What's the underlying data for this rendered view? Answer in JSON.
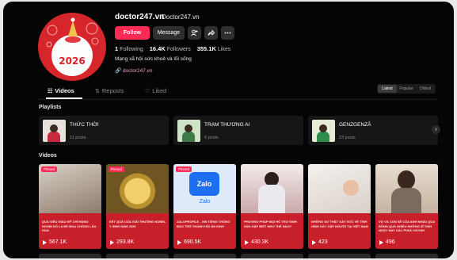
{
  "profile": {
    "username": "doctor247.vn",
    "handle": "Doctor247.vn",
    "avatar_year": "2026",
    "follow_label": "Follow",
    "message_label": "Message",
    "following_count": "1",
    "following_label": "Following",
    "followers_count": "16.4K",
    "followers_label": "Followers",
    "likes_count": "355.1K",
    "likes_label": "Likes",
    "bio": "Mạng xã hội sức khoẻ và lối sống",
    "link": "doctor247.vn"
  },
  "tabs": {
    "videos": "Videos",
    "reposts": "Reposts",
    "liked": "Liked"
  },
  "sort": {
    "latest": "Latest",
    "popular": "Popular",
    "oldest": "Oldest"
  },
  "sections": {
    "playlists": "Playlists",
    "videos": "Videos"
  },
  "playlists": [
    {
      "title": "THỨC THỜI",
      "count": "11 posts"
    },
    {
      "title": "TRẠM THƯƠNG AI",
      "count": "6 posts"
    },
    {
      "title": "GENZGENZĂ",
      "count": "23 posts"
    }
  ],
  "videos": [
    {
      "pinned": "Pinned",
      "caption": "Quá siêu giàu mỹ chỉ hàng nghìn đô la để mua chồng lâu hoa",
      "views": "567.1K"
    },
    {
      "pinned": "Pinned",
      "caption": "Kết quả của giải thưởng Nobel y sinh năm 2025",
      "views": "293.8K"
    },
    {
      "pinned": "Pinned",
      "caption": "Zaloprofile - xin tiếng thông báo trở thành hội ăn kinh",
      "views": "690.5K"
    },
    {
      "pinned": "",
      "caption": "Phương pháp mọi hỗ trợ sinh sản gặp biết như thế nào?",
      "views": "430.3K"
    },
    {
      "pinned": "",
      "caption": "Những sự thật gây sốc về tình hình dầy gập người tại Việt Nam",
      "views": "423"
    },
    {
      "pinned": "",
      "caption": "Vợ và con sẻ của anh Nhậu qua bỗng quá nhiều những sĩ tinh ngày nay các phục huynh",
      "views": "496"
    }
  ],
  "colors": {
    "accent": "#fe2c55",
    "background": "#050505",
    "brand_red": "#d7262b"
  }
}
